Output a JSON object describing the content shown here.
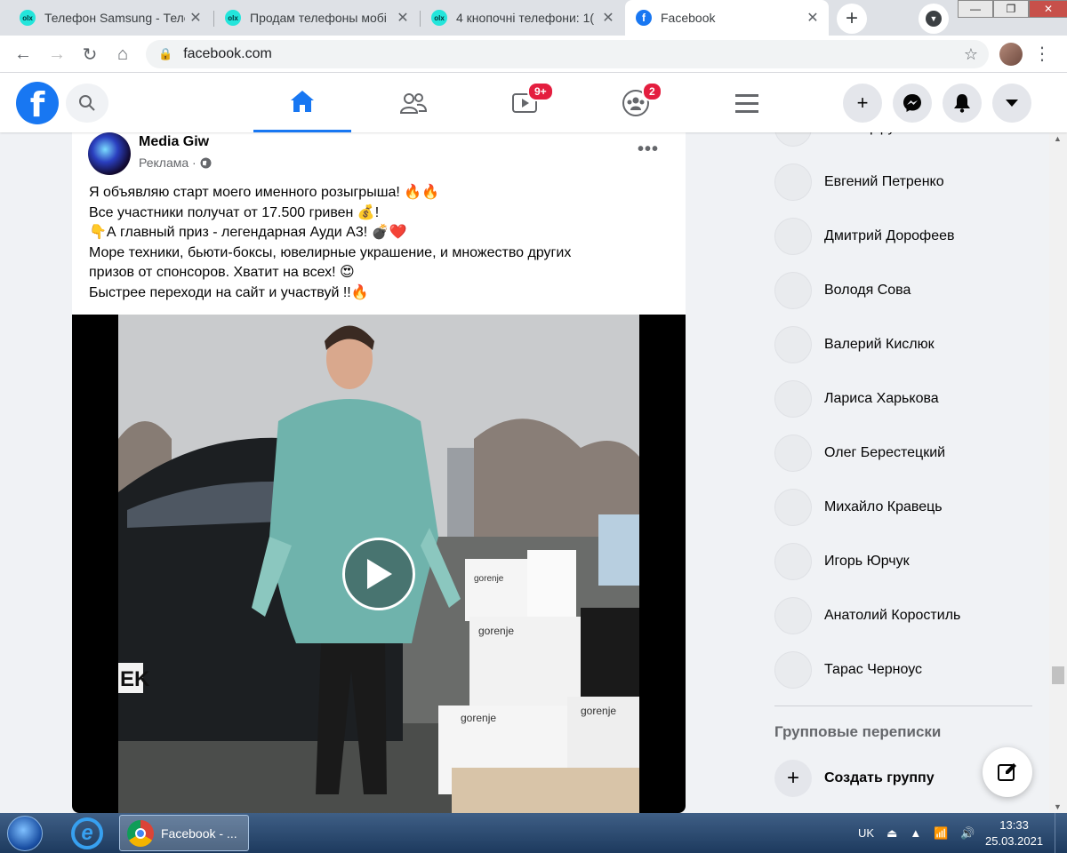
{
  "browser": {
    "tabs": [
      {
        "title": "Телефон Samsung - Теле",
        "icon": "olx-icon"
      },
      {
        "title": "Продам телефоны мобі",
        "icon": "olx-icon"
      },
      {
        "title": "4 кнопочні телефони: 1(",
        "icon": "olx-icon"
      },
      {
        "title": "Facebook",
        "icon": "facebook-icon",
        "active": true
      }
    ],
    "url": "facebook.com",
    "fav_olx_text": "olx",
    "fav_fb_text": "f"
  },
  "fb_header": {
    "logo_text": "f",
    "watch_badge": "9+",
    "groups_badge": "2"
  },
  "post": {
    "author": "Media Giw",
    "meta": "Реклама ·",
    "more": "•••",
    "lines": [
      "Я объявляю старт моего именного розыгрыша! 🔥🔥",
      "Все участники получат от  17.500 гривен 💰!",
      "👇А главный приз - легендарная Ауди А3! 💣❤️",
      "Море техники, бьюти-боксы, ювелирные украшение, и множество других",
      "призов от спонсоров. Хватит на всех! 😍",
      "Быстрее переходи на сайт и участвуй !!🔥"
    ],
    "video_labels": {
      "plate": "EK",
      "brand1": "gorenje",
      "brand2": "gorenje",
      "brand3": "gorenje",
      "brand4": "gorenje"
    }
  },
  "contacts": [
    "Иван Цирук",
    "Евгений Петренко",
    "Дмитрий Дорофеев",
    "Володя Сова",
    "Валерий Кислюк",
    "Лариса Харькова",
    "Олег Берестецкий",
    "Михайло Кравець",
    "Игорь Юрчук",
    "Анатолий Коростиль",
    "Тарас Черноус"
  ],
  "group_chats": {
    "title": "Групповые переписки",
    "create_label": "Создать группу"
  },
  "taskbar": {
    "task_label": "Facebook - ...",
    "lang": "UK",
    "time": "13:33",
    "date": "25.03.2021"
  }
}
